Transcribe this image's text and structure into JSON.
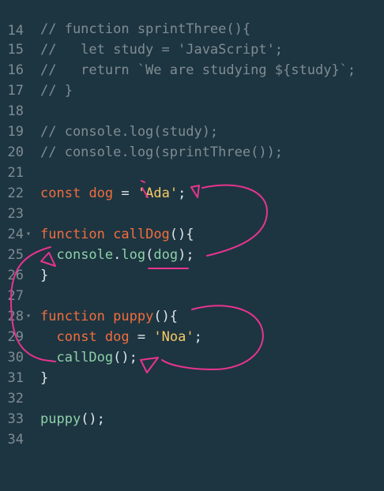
{
  "lines": [
    {
      "num": "14",
      "text": ""
    },
    {
      "num": "15",
      "text": "// function sprintThree(){"
    },
    {
      "num": "16",
      "text": "//   let study = 'JavaScript';"
    },
    {
      "num": "17",
      "text": "//   return `We are studying ${study}`;"
    },
    {
      "num": "18",
      "text": "// }"
    },
    {
      "num": "19",
      "text": ""
    },
    {
      "num": "20",
      "text": "// console.log(study);"
    },
    {
      "num": "21",
      "text": "// console.log(sprintThree());"
    },
    {
      "num": "22",
      "text": ""
    },
    {
      "num": "23",
      "tokens": {
        "kw": "const",
        "var": "dog",
        "op": "=",
        "str": "'Ada'",
        "end": ";"
      }
    },
    {
      "num": "24",
      "text": ""
    },
    {
      "num": "25",
      "tokens": {
        "kw": "function",
        "fn": "callDog",
        "end": "(){"
      }
    },
    {
      "num": "26",
      "tokens": {
        "obj": "console",
        "dot": ".",
        "mth": "log",
        "open": "(",
        "arg": "dog",
        "close": ");"
      }
    },
    {
      "num": "27",
      "text": "}"
    },
    {
      "num": "28",
      "text": ""
    },
    {
      "num": "29",
      "tokens": {
        "kw": "function",
        "fn": "puppy",
        "end": "(){"
      }
    },
    {
      "num": "30",
      "tokens": {
        "kw": "const",
        "var": "dog",
        "op": "=",
        "str": "'Noa'",
        "end": ";"
      }
    },
    {
      "num": "31",
      "tokens": {
        "mth": "callDog",
        "end": "();"
      }
    },
    {
      "num": "32",
      "text": "}"
    },
    {
      "num": "33",
      "text": ""
    },
    {
      "num": "34",
      "tokens": {
        "mth": "puppy",
        "end": "();"
      }
    }
  ],
  "colors": {
    "background": "#1d3541",
    "comment": "#7f8c92",
    "keyword": "#f26d3d",
    "string": "#f7ca64",
    "method": "#8ed0a8",
    "annotation": "#e8348f"
  }
}
